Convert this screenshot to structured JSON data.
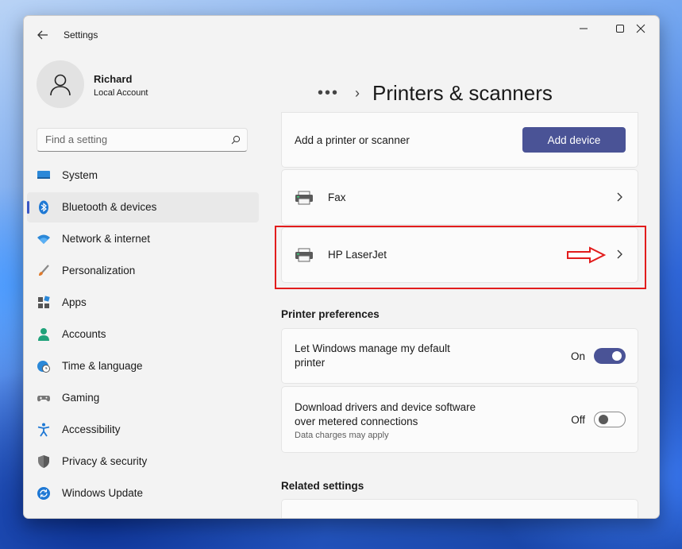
{
  "window": {
    "title": "Settings"
  },
  "profile": {
    "name": "Richard",
    "account": "Local Account"
  },
  "search": {
    "placeholder": "Find a setting"
  },
  "nav": {
    "items": [
      {
        "label": "System",
        "icon": "system-icon"
      },
      {
        "label": "Bluetooth & devices",
        "icon": "bluetooth-icon",
        "selected": true
      },
      {
        "label": "Network & internet",
        "icon": "wifi-icon"
      },
      {
        "label": "Personalization",
        "icon": "brush-icon"
      },
      {
        "label": "Apps",
        "icon": "apps-icon"
      },
      {
        "label": "Accounts",
        "icon": "accounts-icon"
      },
      {
        "label": "Time & language",
        "icon": "globe-clock-icon"
      },
      {
        "label": "Gaming",
        "icon": "gamepad-icon"
      },
      {
        "label": "Accessibility",
        "icon": "accessibility-icon"
      },
      {
        "label": "Privacy & security",
        "icon": "shield-icon"
      },
      {
        "label": "Windows Update",
        "icon": "update-icon"
      }
    ]
  },
  "breadcrumb": {
    "more": "•••",
    "separator": "›"
  },
  "page": {
    "title": "Printers & scanners"
  },
  "add_printer": {
    "label": "Add a printer or scanner",
    "button": "Add device"
  },
  "devices": [
    {
      "name": "Fax",
      "icon": "printer-icon"
    },
    {
      "name": "HP LaserJet",
      "icon": "printer-icon",
      "highlighted": true
    }
  ],
  "printer_preferences": {
    "heading": "Printer preferences",
    "default_printer": {
      "line1": "Let Windows manage my default",
      "line2": "printer",
      "state": "On",
      "on": true
    },
    "metered": {
      "line1": "Download drivers and device software",
      "line2": "over metered connections",
      "sub": "Data charges may apply",
      "state": "Off",
      "on": false
    }
  },
  "related": {
    "heading": "Related settings"
  },
  "colors": {
    "accent": "#4a5396",
    "highlight": "#e21c1c",
    "selected_indicator": "#3a57c4"
  }
}
